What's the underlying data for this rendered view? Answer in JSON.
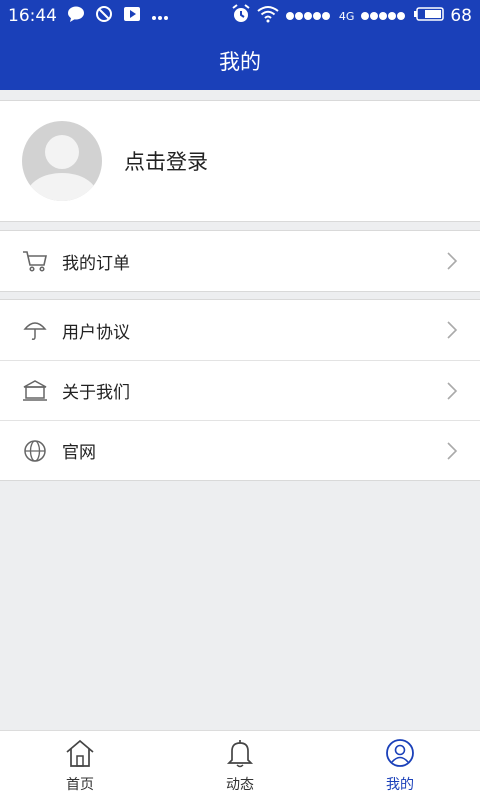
{
  "status_bar": {
    "time": "16:44",
    "network": "4G",
    "battery": "68",
    "icons": [
      "chat-bubble-icon",
      "blocked-icon",
      "play-icon",
      "more-icon",
      "alarm-icon",
      "wifi-icon",
      "signal-dots-icon",
      "battery-icon"
    ]
  },
  "header": {
    "title": "我的"
  },
  "profile": {
    "login_label": "点击登录",
    "avatar_icon": "default-avatar-icon"
  },
  "menu": {
    "orders": {
      "label": "我的订单",
      "icon": "cart-icon"
    },
    "agreement": {
      "label": "用户协议",
      "icon": "umbrella-icon"
    },
    "about": {
      "label": "关于我们",
      "icon": "building-icon"
    },
    "website": {
      "label": "官网",
      "icon": "globe-icon"
    }
  },
  "tabs": [
    {
      "label": "首页",
      "icon": "home-icon",
      "active": false
    },
    {
      "label": "动态",
      "icon": "bell-icon",
      "active": false
    },
    {
      "label": "我的",
      "icon": "user-icon",
      "active": true
    }
  ],
  "colors": {
    "brand": "#1a40b9",
    "background": "#edeef0",
    "text": "#222222"
  }
}
